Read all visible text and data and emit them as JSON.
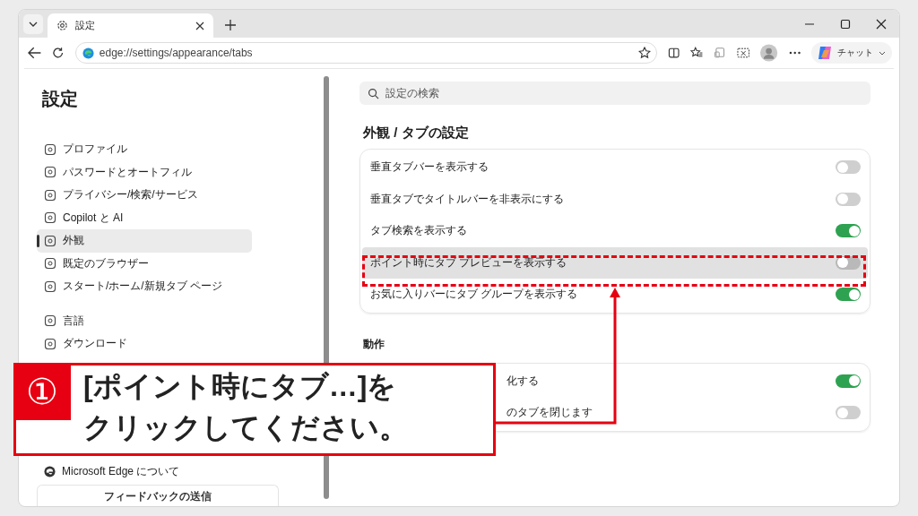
{
  "browser": {
    "tab_title": "設定",
    "address": "edge://settings/appearance/tabs",
    "chat_label": "チャット"
  },
  "sidebar": {
    "title": "設定",
    "groups": [
      [
        {
          "label": "プロファイル",
          "selected": false
        },
        {
          "label": "パスワードとオートフィル",
          "selected": false
        },
        {
          "label": "プライバシー/検索/サービス",
          "selected": false
        },
        {
          "label": "Copilot と AI",
          "selected": false
        },
        {
          "label": "外観",
          "selected": true
        },
        {
          "label": "既定のブラウザー",
          "selected": false
        },
        {
          "label": "スタート/ホーム/新規タブ ページ",
          "selected": false
        }
      ],
      [
        {
          "label": "言語",
          "selected": false
        },
        {
          "label": "ダウンロード",
          "selected": false
        }
      ]
    ],
    "about": "Microsoft Edge について",
    "feedback": "フィードバックの送信"
  },
  "main": {
    "search": {
      "placeholder": "設定の検索"
    },
    "heading": "外観 / タブの設定",
    "toggles": [
      {
        "label": "垂直タブバーを表示する",
        "on": false,
        "highlighted": false
      },
      {
        "label": "垂直タブでタイトルバーを非表示にする",
        "on": false,
        "highlighted": false
      },
      {
        "label": "タブ検索を表示する",
        "on": true,
        "highlighted": false
      },
      {
        "label": "ポイント時にタブ プレビューを表示する",
        "on": false,
        "highlighted": true
      },
      {
        "label": "お気に入りバーにタブ グループを表示する",
        "on": true,
        "highlighted": false
      }
    ],
    "section": "動作",
    "section_toggles": [
      {
        "label": "化する",
        "on": true
      },
      {
        "label": "のタブを閉じます",
        "on": false
      }
    ]
  },
  "callout": {
    "number": "①",
    "lines": [
      "[ポイント時にタブ…]を",
      "クリックしてください。"
    ]
  }
}
